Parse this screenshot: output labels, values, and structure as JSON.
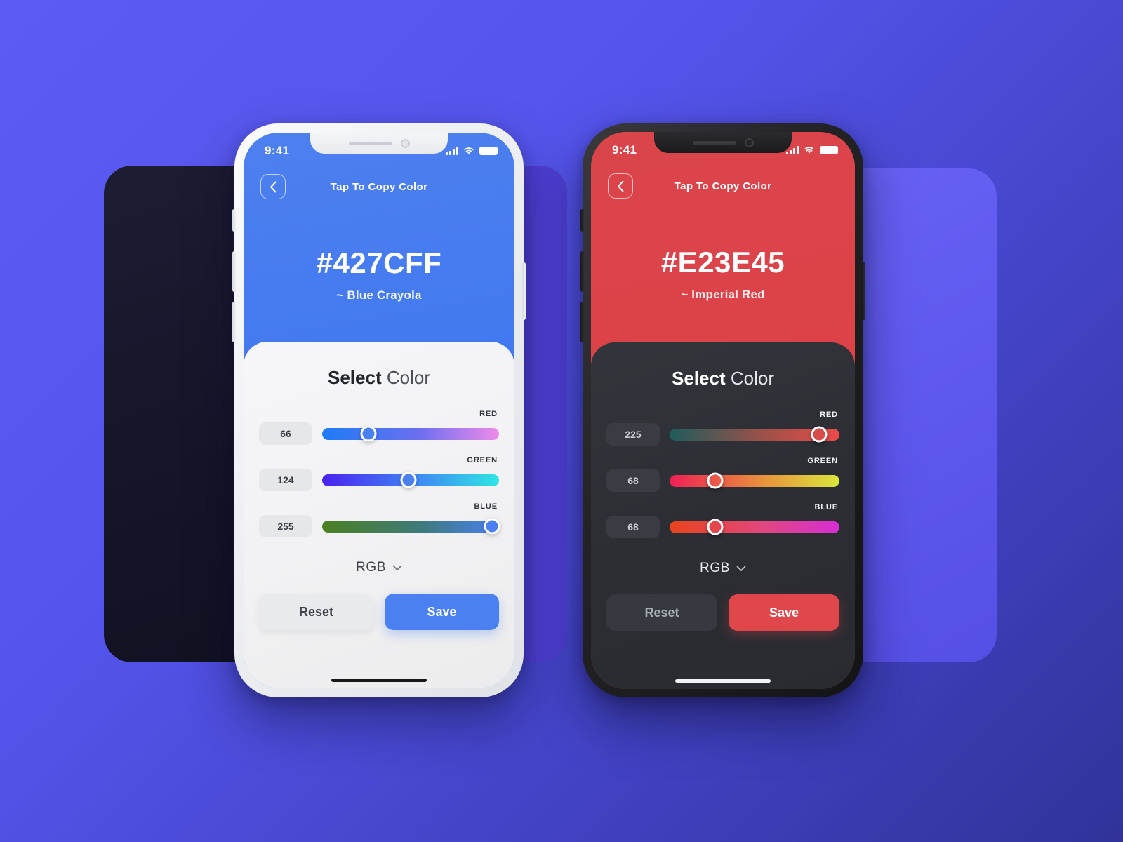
{
  "background": {
    "gradient_from": "#5C5CF2",
    "gradient_to": "#32329A",
    "dark_panel_color": "#141427",
    "wave_color": "#4F40D6",
    "light_panel_color": "#6A63F5"
  },
  "phones": [
    {
      "theme": "light",
      "frame_color": "#ECEEF1",
      "accent": "#4178F0",
      "status": {
        "time": "9:41",
        "signal_icon": "signal-bars-icon",
        "wifi_icon": "wifi-icon",
        "battery_icon": "battery-icon"
      },
      "nav": {
        "back_icon": "chevron-left-icon",
        "title": "Tap To Copy Color"
      },
      "hero": {
        "hex": "#427CFF",
        "name": "~ Blue Crayola"
      },
      "sheet": {
        "title_bold": "Select",
        "title_light": "Color",
        "sliders": [
          {
            "label": "RED",
            "value": "66",
            "percent": 26,
            "from": "#1E7BF5",
            "mid": "#6C6FF0",
            "to": "#EE8BE8"
          },
          {
            "label": "GREEN",
            "value": "124",
            "percent": 49,
            "from": "#4A22F0",
            "mid": "#3F8AF2",
            "to": "#2FE6E6"
          },
          {
            "label": "BLUE",
            "value": "255",
            "percent": 96,
            "from": "#4C8022",
            "mid": "#3E7A78",
            "to": "#4A80F0"
          }
        ],
        "mode": {
          "label": "RGB",
          "chevron_icon": "chevron-down-icon"
        },
        "actions": {
          "reset_label": "Reset",
          "save_label": "Save"
        }
      },
      "home_indicator": true
    },
    {
      "theme": "dark",
      "frame_color": "#232326",
      "accent": "#E0474D",
      "status": {
        "time": "9:41",
        "signal_icon": "signal-bars-icon",
        "wifi_icon": "wifi-icon",
        "battery_icon": "battery-icon"
      },
      "nav": {
        "back_icon": "chevron-left-icon",
        "title": "Tap To Copy Color"
      },
      "hero": {
        "hex": "#E23E45",
        "name": "~ Imperial Red"
      },
      "sheet": {
        "title_bold": "Select",
        "title_light": "Color",
        "sliders": [
          {
            "label": "RED",
            "value": "225",
            "percent": 88,
            "from": "#1F5C5C",
            "mid": "#9B5149",
            "to": "#EE4A4A"
          },
          {
            "label": "GREEN",
            "value": "68",
            "percent": 27,
            "from": "#EE1F56",
            "mid": "#E8923C",
            "to": "#D9E63C"
          },
          {
            "label": "BLUE",
            "value": "68",
            "percent": 27,
            "from": "#E8441C",
            "mid": "#E2477E",
            "to": "#D62ED6"
          }
        ],
        "mode": {
          "label": "RGB",
          "chevron_icon": "chevron-down-icon"
        },
        "actions": {
          "reset_label": "Reset",
          "save_label": "Save"
        }
      },
      "home_indicator": true
    }
  ]
}
